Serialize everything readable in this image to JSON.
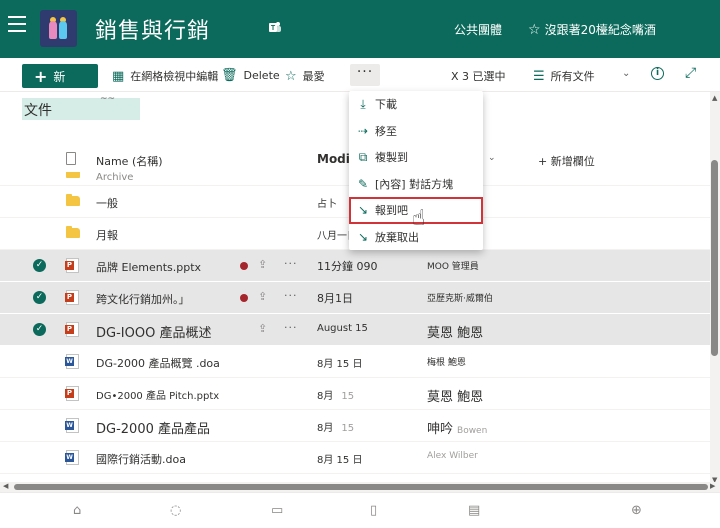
{
  "header": {
    "site_title": "銷售與行銷",
    "group_type": "公共團體",
    "follow_label": "沒跟著20檯紀念嘴酒",
    "bg_color": "#0b6a5b"
  },
  "toolbar": {
    "new_label": "新",
    "grid_edit_label": "在網格檢視中編輯",
    "delete_label": "Delete",
    "favorite_label": "最愛",
    "more_label": "···",
    "selection_label": "X 3 已選中",
    "view_label": "所有文件"
  },
  "library": {
    "title": "文件",
    "tiny_mark": "~~"
  },
  "columns": {
    "name": "Name (名稱)",
    "modified": "Modified",
    "add_column": "新增欄位"
  },
  "menu": {
    "items": [
      {
        "label": "下載",
        "icon": "download-icon"
      },
      {
        "label": "移至",
        "icon": "move-icon"
      },
      {
        "label": "複製到",
        "icon": "copy-icon"
      },
      {
        "label": "[內容] 對話方塊",
        "icon": "edit-icon"
      },
      {
        "label": "報到吧",
        "icon": "checkin-icon"
      },
      {
        "label": "放棄取出",
        "icon": "discard-checkout-icon"
      }
    ]
  },
  "files": {
    "archive": {
      "name": "Archive",
      "modified": "",
      "by": ""
    },
    "rows": [
      {
        "name": "一般",
        "modified": "占卜",
        "modified_extra": "",
        "by": "",
        "by_extra": ""
      },
      {
        "name": "月報",
        "modified": "八月一日",
        "modified_extra": "",
        "by": "",
        "by_extra": ""
      },
      {
        "name": "品牌 Elements.pptx",
        "modified": "11分鐘 090",
        "modified_extra": "",
        "by": "MOO 管理員",
        "by_extra": ""
      },
      {
        "name": "跨文化行銷加州。」",
        "modified": "8月1日",
        "modified_extra": "",
        "by": "亞歷克斯·威爾伯",
        "by_extra": ""
      },
      {
        "name": "DG-IOOO 產品概述",
        "modified": "August 15",
        "modified_extra": "",
        "by": "莫恩 鮑恩",
        "by_extra": ""
      },
      {
        "name": "DG-2000 產品概覽 .doa",
        "modified": "8月 15 日",
        "modified_extra": "",
        "by": "梅根 鮑恩",
        "by_extra": ""
      },
      {
        "name": "DG•2000 產品 Pitch.pptx",
        "modified": "8月",
        "modified_extra": "15",
        "by": "莫恩 鮑恩",
        "by_extra": ""
      },
      {
        "name": "DG-2000 產品產品",
        "modified": "8月",
        "modified_extra": "15",
        "by": "呻吟",
        "by_extra": "Bowen"
      },
      {
        "name": "國際行銷活動.doa",
        "modified": "8月 15 日",
        "modified_extra": "",
        "by": "Alex Wilber",
        "by_extra": ""
      }
    ]
  }
}
